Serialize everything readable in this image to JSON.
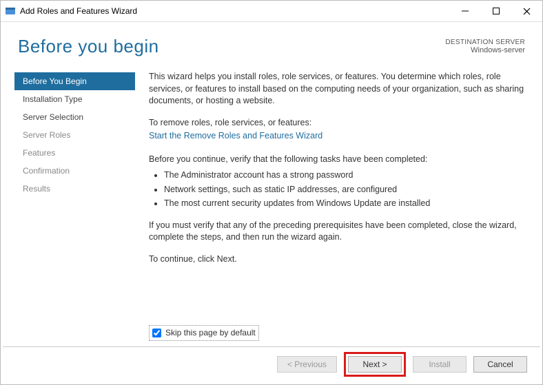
{
  "window": {
    "title": "Add Roles and Features Wizard"
  },
  "header": {
    "page_title": "Before you begin",
    "dest_label": "DESTINATION SERVER",
    "dest_server": "Windows-server"
  },
  "sidebar": {
    "items": [
      {
        "label": "Before You Begin"
      },
      {
        "label": "Installation Type"
      },
      {
        "label": "Server Selection"
      },
      {
        "label": "Server Roles"
      },
      {
        "label": "Features"
      },
      {
        "label": "Confirmation"
      },
      {
        "label": "Results"
      }
    ]
  },
  "content": {
    "intro": "This wizard helps you install roles, role services, or features. You determine which roles, role services, or features to install based on the computing needs of your organization, such as sharing documents, or hosting a website.",
    "remove_heading": "To remove roles, role services, or features:",
    "remove_link": "Start the Remove Roles and Features Wizard",
    "verify_heading": "Before you continue, verify that the following tasks have been completed:",
    "bullets": {
      "0": "The Administrator account has a strong password",
      "1": "Network settings, such as static IP addresses, are configured",
      "2": "The most current security updates from Windows Update are installed"
    },
    "verify_note": "If you must verify that any of the preceding prerequisites have been completed, close the wizard, complete the steps, and then run the wizard again.",
    "continue_note": "To continue, click Next.",
    "skip_label": "Skip this page by default"
  },
  "footer": {
    "previous": "< Previous",
    "next": "Next >",
    "install": "Install",
    "cancel": "Cancel"
  }
}
